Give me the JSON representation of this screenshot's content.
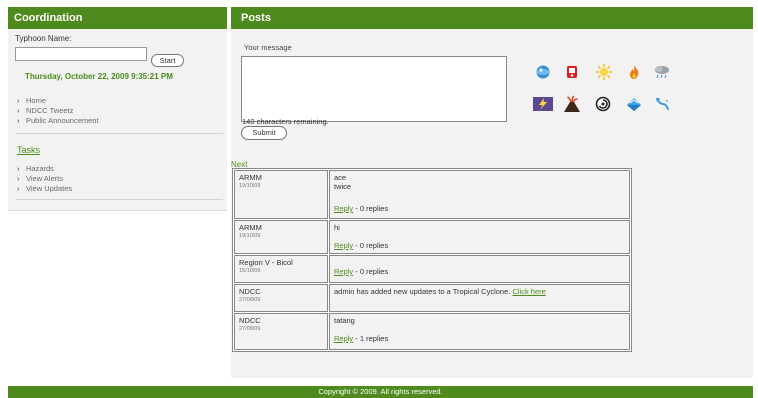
{
  "sidebar": {
    "title": "Coordination",
    "typhoon_label": "Typhoon Name:",
    "typhoon_value": "",
    "start_label": "Start",
    "datetime": "Thursday, October 22, 2009 9:35:21 PM",
    "nav": [
      {
        "label": "Home"
      },
      {
        "label": "NDCC Tweetz"
      },
      {
        "label": "Public Announcement"
      }
    ],
    "tasks_heading": "Tasks",
    "tasks": [
      {
        "label": "Hazards"
      },
      {
        "label": "View Alerts"
      },
      {
        "label": "View Updates"
      }
    ]
  },
  "main": {
    "title": "Posts",
    "message_label": "Your message",
    "message_value": "",
    "chars_remaining": "140 characters remaining.",
    "submit_label": "Submit",
    "hazard_icons": [
      "globe-icon",
      "fire-alarm-icon",
      "sun-icon",
      "fire-icon",
      "rain-cloud-icon",
      "lightning-icon",
      "volcano-icon",
      "cyclone-icon",
      "flood-icon",
      "landslide-icon"
    ],
    "next_label": "Next",
    "reply_label": "Reply",
    "posts": [
      {
        "author": "ARMM",
        "date": "19/10/09",
        "lines": [
          "ace",
          "twice"
        ],
        "reply_suffix": " - 0 replies",
        "has_reply": true
      },
      {
        "author": "ARMM",
        "date": "19/10/09",
        "lines": [
          "hi"
        ],
        "reply_suffix": " - 0 replies",
        "has_reply": true
      },
      {
        "author": "Region V - Bicol",
        "date": "15/10/09",
        "lines": [],
        "reply_suffix": " - 0 replies",
        "has_reply": true
      },
      {
        "author": "NDCC",
        "date": "27/08/09",
        "lines": [
          "admin has added new updates to a Tropical Cyclone."
        ],
        "link_text": "Click here",
        "has_reply": false
      },
      {
        "author": "NDCC",
        "date": "27/08/09",
        "lines": [
          "tatang"
        ],
        "reply_suffix": " - 1 replies",
        "has_reply": true
      }
    ]
  },
  "footer": {
    "text": "Copyright © 2009. All rights reserved."
  },
  "colors": {
    "brand_green": "#4f8a1e",
    "link_green": "#4d8b1c",
    "panel_bg": "#f2f2f2"
  }
}
